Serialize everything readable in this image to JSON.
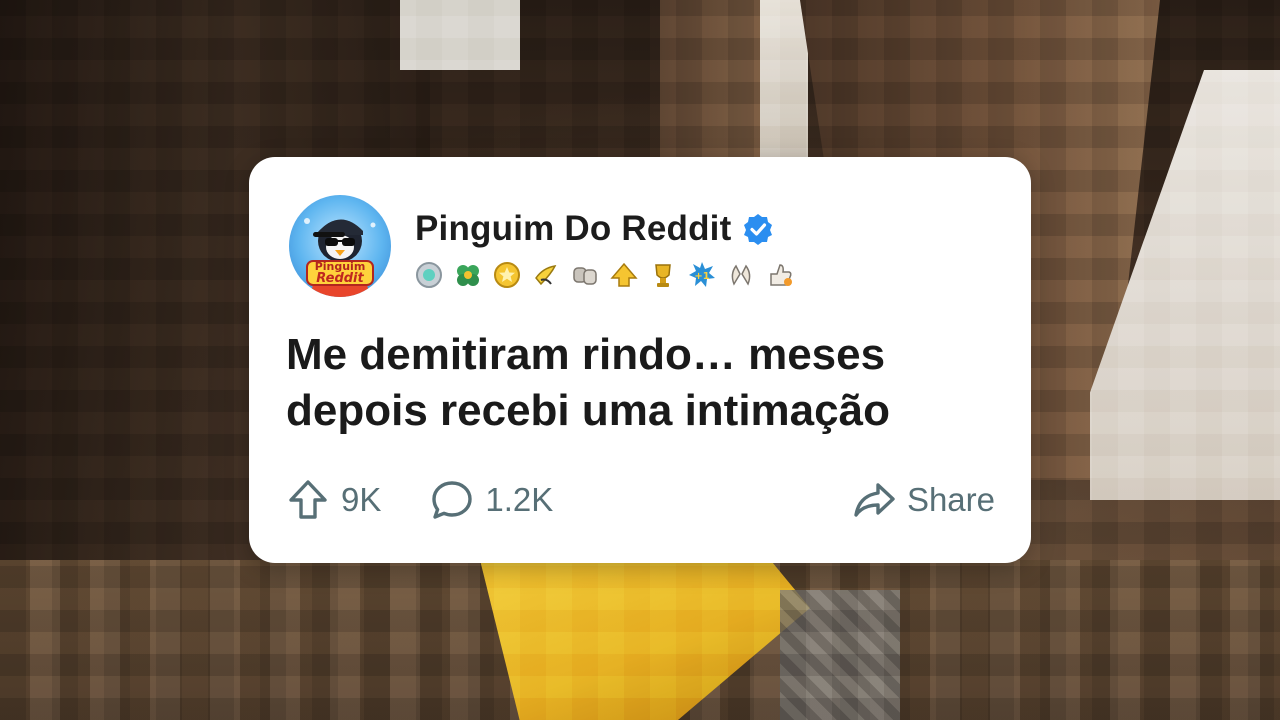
{
  "post": {
    "author": "Pinguim Do Reddit",
    "title": "Me demitiram rindo… meses depois recebi uma intimação",
    "avatar_text": [
      "Pinguim",
      "Reddit"
    ],
    "badges": [
      "silver-medal-icon",
      "clover-icon",
      "gold-star-icon",
      "banana-icon",
      "fist-bump-icon",
      "gold-arrow-icon",
      "trophy-icon",
      "plus-one-icon",
      "clapping-hands-icon",
      "thumbs-up-icon"
    ],
    "upvotes": "9K",
    "comments": "1.2K",
    "share_label": "Share"
  },
  "colors": {
    "card": "#ffffff",
    "text": "#1a1a1a",
    "action": "#576f76",
    "verified": "#2b8ef0",
    "gold": "#f2cb3a"
  }
}
